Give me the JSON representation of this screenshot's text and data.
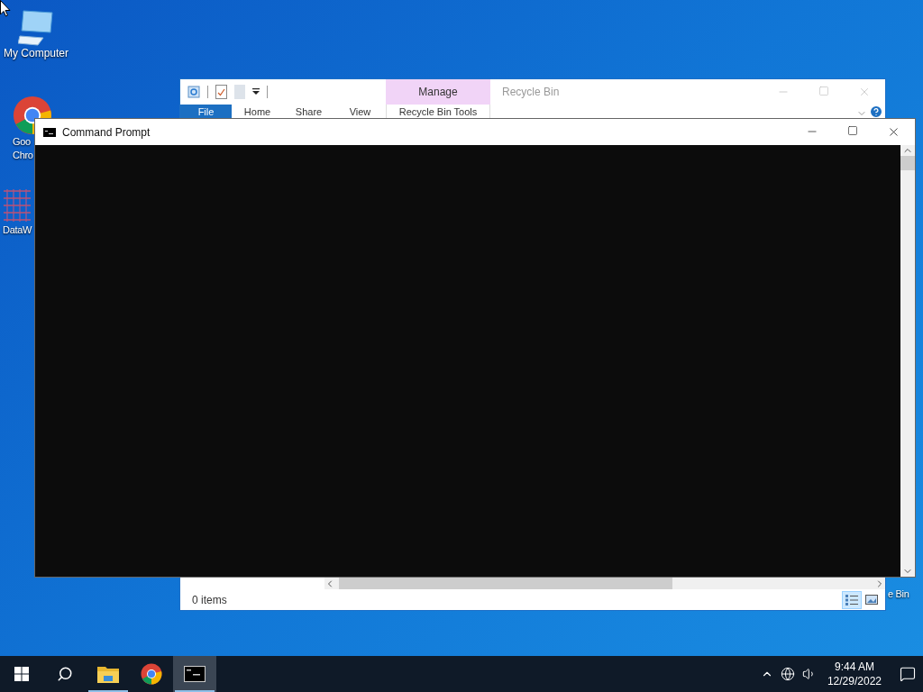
{
  "desktop": {
    "icons": [
      {
        "kind": "computer",
        "lines": [
          "My Computer"
        ]
      },
      {
        "kind": "chrome",
        "lines": [
          "Goo",
          "Chro"
        ]
      },
      {
        "kind": "grid",
        "lines": [
          "DataW"
        ]
      },
      {
        "kind": "hidden",
        "lines": [
          "e Bin"
        ]
      }
    ]
  },
  "explorer": {
    "title": "Recycle Bin",
    "context_group": "Manage",
    "context_tab": "Recycle Bin Tools",
    "tabs": [
      {
        "label": "File",
        "kind": "file"
      },
      {
        "label": "Home",
        "kind": "tab"
      },
      {
        "label": "Share",
        "kind": "tab"
      },
      {
        "label": "View",
        "kind": "tab"
      }
    ],
    "status": "0 items",
    "views": [
      {
        "kind": "details",
        "selected": true
      },
      {
        "kind": "tiles",
        "selected": false
      }
    ]
  },
  "console": {
    "title": "Command Prompt"
  },
  "taskbar": {
    "items": [
      {
        "kind": "start",
        "active": false,
        "open": false
      },
      {
        "kind": "search",
        "active": false,
        "open": false
      },
      {
        "kind": "folder",
        "active": false,
        "open": true
      },
      {
        "kind": "chrome",
        "active": false,
        "open": false
      },
      {
        "kind": "console",
        "active": true,
        "open": true
      }
    ],
    "time": "9:44 AM",
    "date": "12/29/2022"
  }
}
